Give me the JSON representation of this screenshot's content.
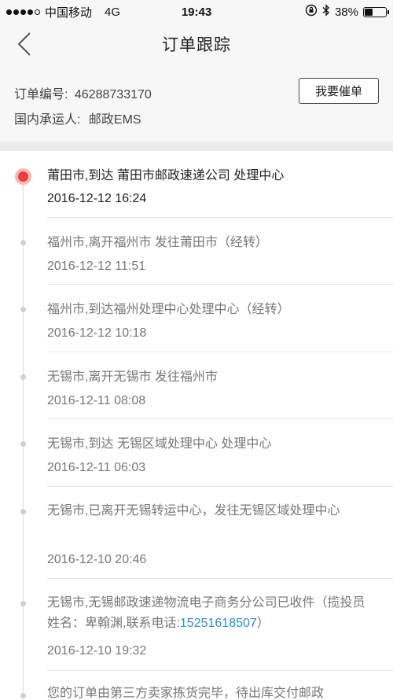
{
  "status_bar": {
    "carrier": "中国移动",
    "network": "4G",
    "time": "19:43",
    "battery": "38%",
    "battery_level": 0.38
  },
  "nav": {
    "title": "订单跟踪"
  },
  "order": {
    "number_label": "订单编号:",
    "number": "46288733170",
    "carrier_label": "国内承运人:",
    "carrier": "邮政EMS",
    "urge_button": "我要催单"
  },
  "timeline": [
    {
      "text": "莆田市,到达  莆田市邮政速递公司 处理中心",
      "time": "2016-12-12 16:24"
    },
    {
      "text": "福州市,离开福州市 发往莆田市（经转）",
      "time": "2016-12-12 11:51"
    },
    {
      "text": "福州市,到达福州处理中心处理中心（经转）",
      "time": "2016-12-12 10:18"
    },
    {
      "text": "无锡市,离开无锡市 发往福州市",
      "time": "2016-12-11 08:08"
    },
    {
      "text": "无锡市,到达  无锡区域处理中心 处理中心",
      "time": "2016-12-11 06:03"
    },
    {
      "text": "无锡市,已离开无锡转运中心，发往无锡区域处理中心",
      "time": "2016-12-10 20:46"
    },
    {
      "text_before": "无锡市,无锡邮政速递物流电子商务分公司已收件（揽投员姓名：卑翰渊,联系电话:",
      "phone": "15251618507",
      "text_after": "）",
      "time": "2016-12-10 19:32"
    },
    {
      "text": "您的订单由第三方卖家拣货完毕，待出库交付邮政"
    }
  ]
}
